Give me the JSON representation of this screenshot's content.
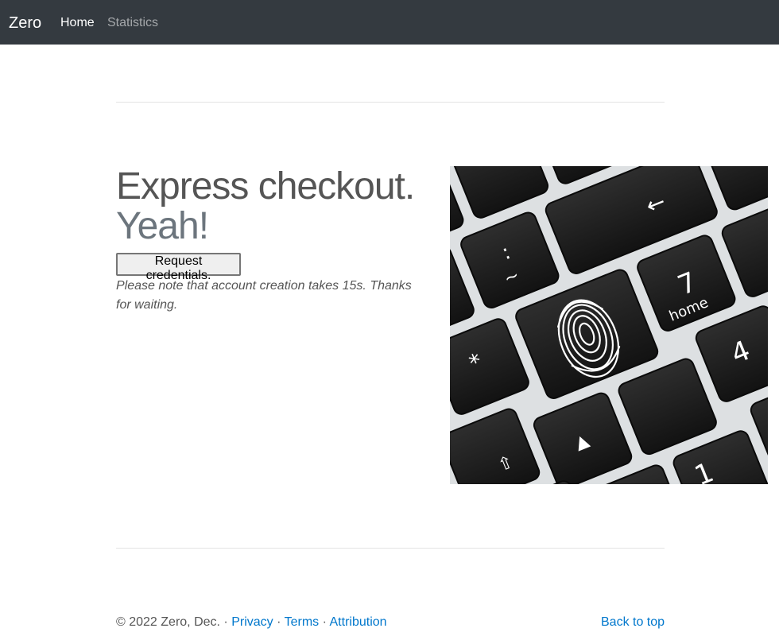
{
  "navbar": {
    "brand": "Zero",
    "links": [
      {
        "label": "Home",
        "active": true
      },
      {
        "label": "Statistics",
        "active": false
      }
    ]
  },
  "hero": {
    "headline_main": "Express checkout.",
    "headline_muted": "Yeah!",
    "button_label": "Request credentials.",
    "note": "Please note that account creation takes 15s. Thanks for waiting."
  },
  "footer": {
    "copyright": "© 2022 Zero, Dec.",
    "separator": "·",
    "links": [
      "Privacy",
      "Terms",
      "Attribution"
    ],
    "back_to_top": "Back to top"
  },
  "colors": {
    "navbar_bg": "#343a40",
    "link": "#0077cc",
    "text": "#555555",
    "muted": "#6c757d"
  },
  "icons": {
    "hero_image": "fingerprint-key-keyboard-image"
  }
}
